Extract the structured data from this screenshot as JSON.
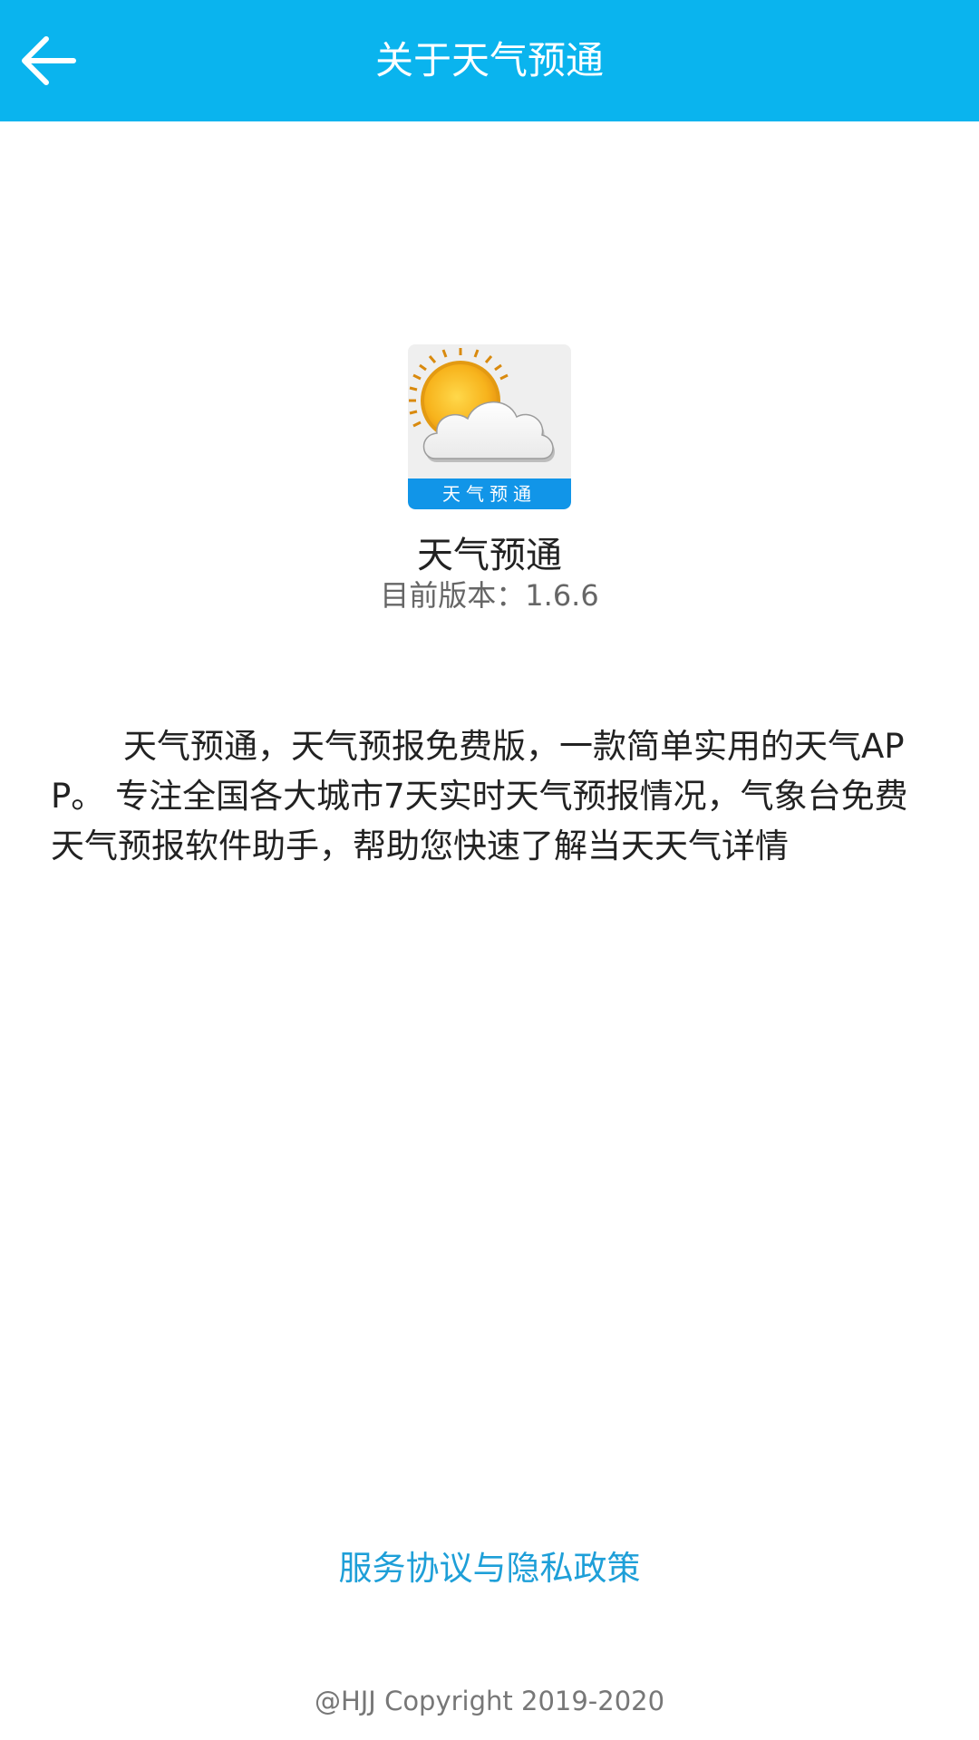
{
  "toolbar": {
    "title": "关于天气预通",
    "back_icon": "arrow-left-icon",
    "background_color": "#0ab4ee"
  },
  "app": {
    "icon": "sun-cloud-app-icon",
    "icon_banner_text": "天气预通",
    "name": "天气预通",
    "version_text": "目前版本：1.6.6"
  },
  "description": "天气预通，天气预报免费版，一款简单实用的天气APP。 专注全国各大城市7天实时天气预报情况，气象台免费天气预报软件助手，帮助您快速了解当天天气详情",
  "footer": {
    "privacy_link": "服务协议与隐私政策",
    "link_color": "#1e9fd8",
    "copyright": "@HJJ Copyright 2019-2020"
  }
}
